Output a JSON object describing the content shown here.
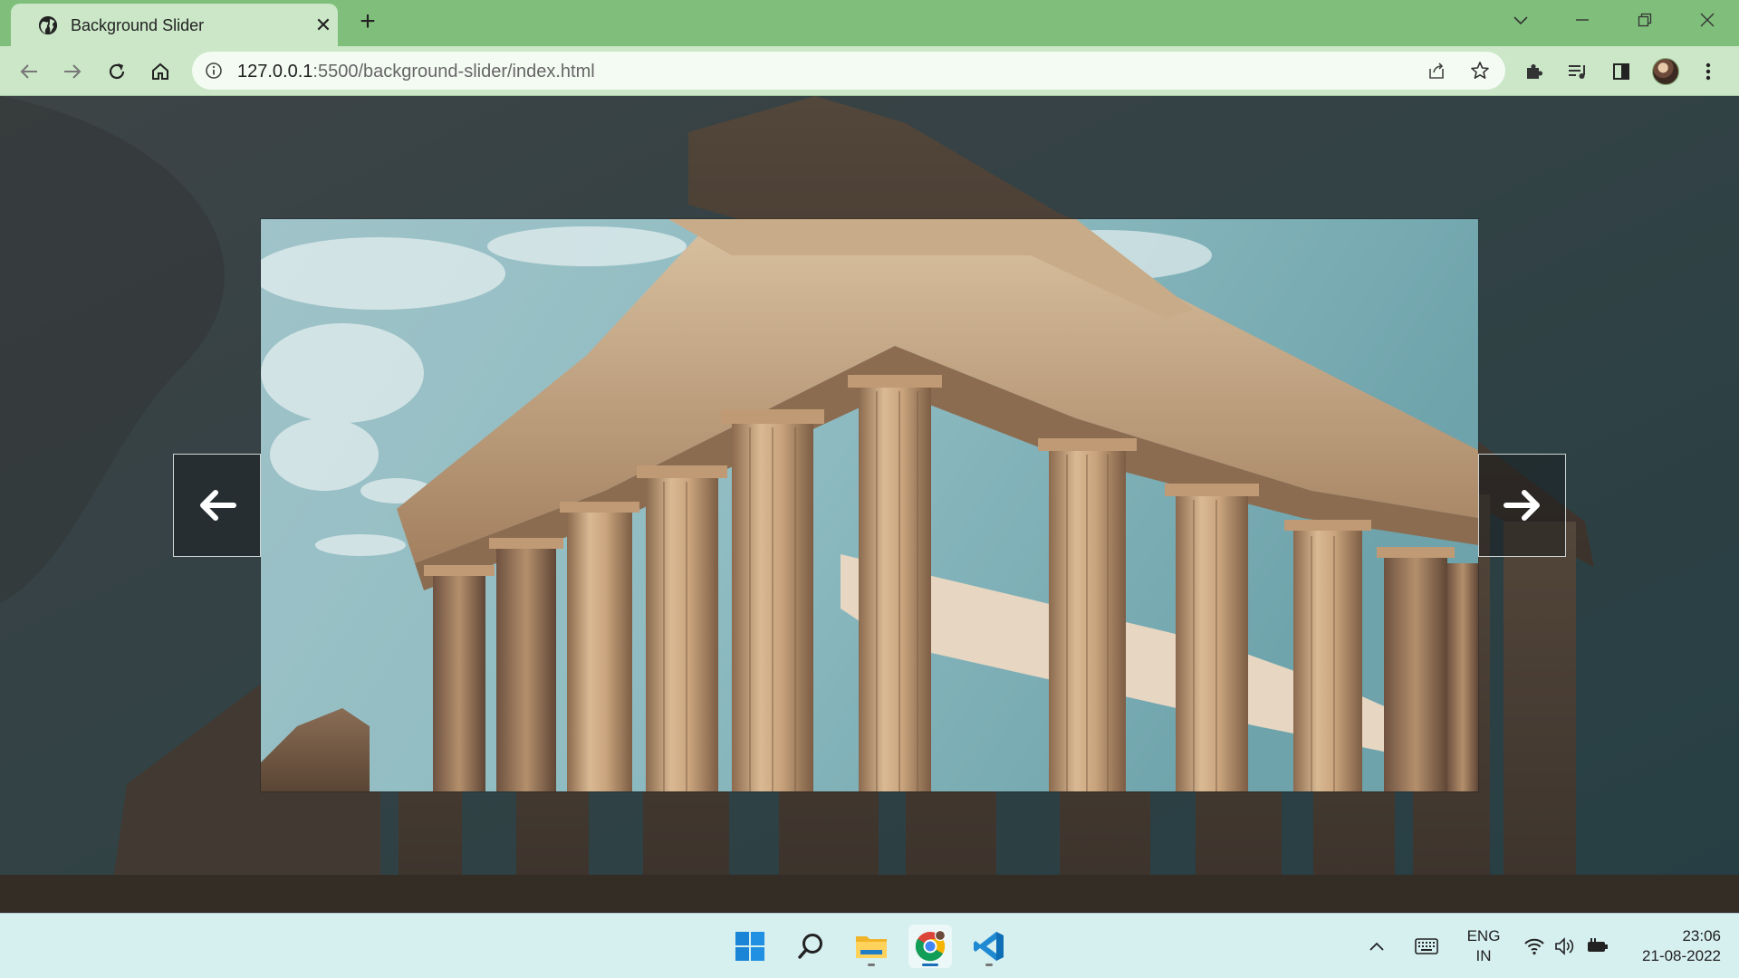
{
  "browser": {
    "tab": {
      "title": "Background Slider"
    },
    "address": {
      "url_host": "127.0.0.1",
      "url_rest": ":5500/background-slider/index.html"
    }
  },
  "slider": {
    "left_arrow_icon": "arrow-left-icon",
    "right_arrow_icon": "arrow-right-icon",
    "current_image": "parthenon-columns"
  },
  "taskbar": {
    "apps": [
      "windows-start",
      "search",
      "file-explorer",
      "chrome",
      "vscode"
    ],
    "language": {
      "line1": "ENG",
      "line2": "IN"
    },
    "clock": {
      "time": "23:06",
      "date": "21-08-2022"
    }
  },
  "colors": {
    "tabstrip": "#7fbf7b",
    "toolbar": "#cbe7c8",
    "taskbar": "#d6efef"
  }
}
